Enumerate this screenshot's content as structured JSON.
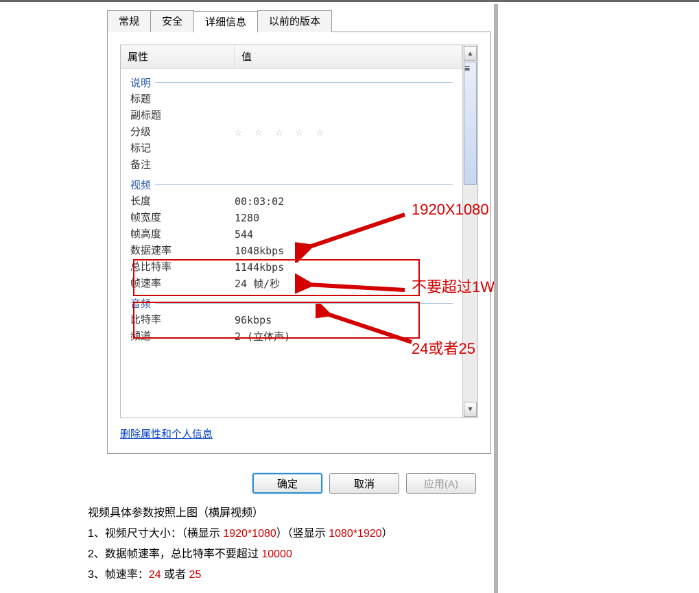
{
  "tabs": {
    "general": "常规",
    "security": "安全",
    "details": "详细信息",
    "previous": "以前的版本"
  },
  "columns": {
    "attr": "属性",
    "value": "值"
  },
  "groups": {
    "desc": "说明",
    "video": "视频",
    "audio": "音频"
  },
  "desc": {
    "title_label": "标题",
    "subtitle_label": "副标题",
    "rating_label": "分级",
    "tags_label": "标记",
    "comments_label": "备注"
  },
  "video": {
    "length_label": "长度",
    "length_val": "00:03:02",
    "fw_label": "帧宽度",
    "fw_val": "1280",
    "fh_label": "帧高度",
    "fh_val": "544",
    "datarate_label": "数据速率",
    "datarate_val": "1048kbps",
    "totalrate_label": "总比特率",
    "totalrate_val": "1144kbps",
    "fps_label": "帧速率",
    "fps_val": "24 帧/秒"
  },
  "audio": {
    "bitrate_label": "比特率",
    "bitrate_val": "96kbps",
    "channel_label": "频道",
    "channel_val": "2 (立体声)"
  },
  "link_remove": "删除属性和个人信息",
  "buttons": {
    "ok": "确定",
    "cancel": "取消",
    "apply": "应用(A)"
  },
  "annotations": {
    "resolution": "1920X1080",
    "limit": "不要超过1W",
    "fps_hint": "24或者25"
  },
  "caption": {
    "line0": "视频具体参数按照上图（横屏视频）",
    "l1a": "1、视频尺寸大小：（横显示 ",
    "l1b": "1920*1080",
    "l1c": "）（竖显示 ",
    "l1d": "1080*1920",
    "l1e": "）",
    "l2a": "2、数据帧速率，总比特率不要超过 ",
    "l2b": "10000",
    "l3a": "3、帧速率：",
    "l3b": "24",
    "l3c": " 或者 ",
    "l3d": "25"
  }
}
